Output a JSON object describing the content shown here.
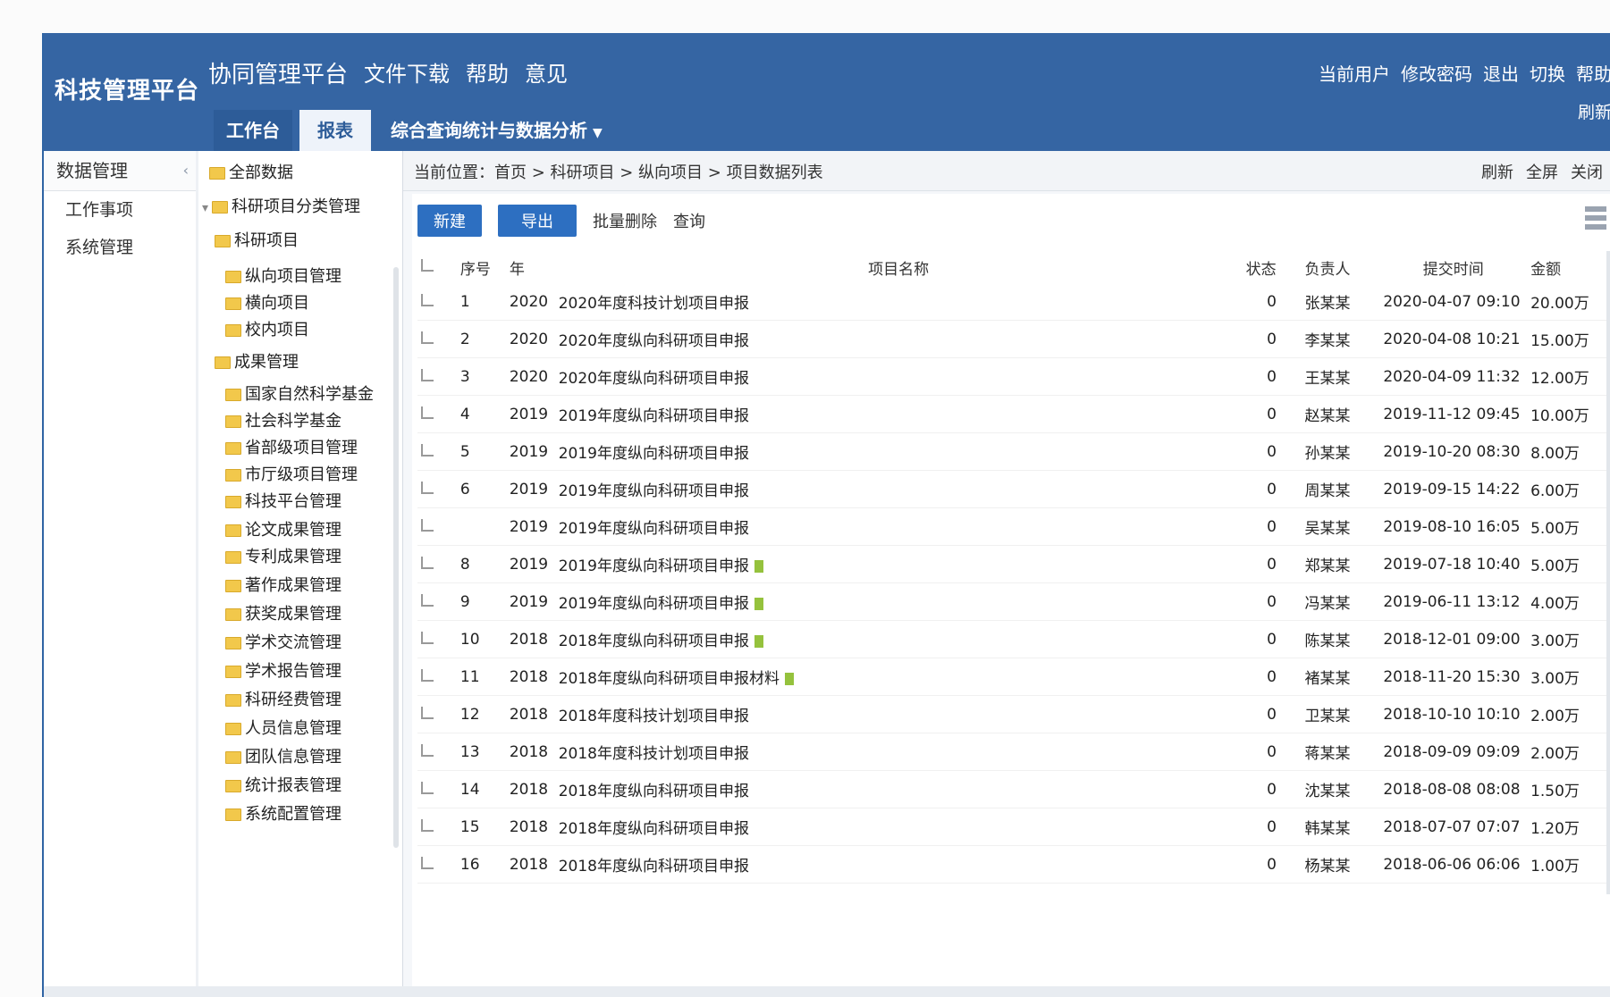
{
  "header": {
    "brand": "科技管理平台",
    "top_links": [
      "协同管理平台",
      "文件下载",
      "帮助",
      "意见"
    ],
    "user_links": [
      "当前用户",
      "修改密码",
      "退出",
      "切换",
      "帮助"
    ],
    "refresh_label": "刷新",
    "nav_tabs": [
      {
        "label": "工作台"
      },
      {
        "label": "报表"
      },
      {
        "label": "综合查询统计与数据分析"
      }
    ]
  },
  "sidebar": {
    "title": "数据管理",
    "items": [
      "工作事项",
      "系统管理"
    ]
  },
  "tree": {
    "nodes": [
      {
        "label": "全部数据"
      },
      {
        "label": "科研项目分类管理"
      },
      {
        "label": "科研项目"
      },
      {
        "label": "纵向项目管理"
      },
      {
        "label": "横向项目"
      },
      {
        "label": "校内项目"
      },
      {
        "label": "成果管理"
      },
      {
        "label": "国家自然科学基金"
      },
      {
        "label": "社会科学基金"
      },
      {
        "label": "省部级项目管理"
      },
      {
        "label": "市厅级项目管理"
      },
      {
        "label": "科技平台管理"
      },
      {
        "label": "论文成果管理"
      },
      {
        "label": "专利成果管理"
      },
      {
        "label": "著作成果管理"
      },
      {
        "label": "获奖成果管理"
      },
      {
        "label": "学术交流管理"
      },
      {
        "label": "学术报告管理"
      },
      {
        "label": "科研经费管理"
      },
      {
        "label": "人员信息管理"
      },
      {
        "label": "团队信息管理"
      },
      {
        "label": "统计报表管理"
      },
      {
        "label": "系统配置管理"
      }
    ]
  },
  "breadcrumb": "当前位置：首页 > 科研项目 > 纵向项目 > 项目数据列表",
  "breadcrumb_actions": [
    "刷新",
    "全屏",
    "关闭"
  ],
  "toolbar": {
    "primary_buttons": [
      "新建",
      "导出"
    ],
    "links": [
      "批量删除",
      "查询"
    ]
  },
  "table": {
    "headers": [
      "",
      "序号",
      "年",
      "项目名称",
      "状态",
      "负责人",
      "提交时间",
      "金额"
    ],
    "rows": [
      {
        "index": "1",
        "year": "2020",
        "name": "2020年度科技计划项目申报",
        "status": "0",
        "owner": "张某某",
        "time": "2020-04-07 09:10",
        "amount": "20.00万"
      },
      {
        "index": "2",
        "year": "2020",
        "name": "2020年度纵向科研项目申报",
        "status": "0",
        "owner": "李某某",
        "time": "2020-04-08 10:21",
        "amount": "15.00万"
      },
      {
        "index": "3",
        "year": "2020",
        "name": "2020年度纵向科研项目申报",
        "status": "0",
        "owner": "王某某",
        "time": "2020-04-09 11:32",
        "amount": "12.00万"
      },
      {
        "index": "4",
        "year": "2019",
        "name": "2019年度纵向科研项目申报",
        "status": "0",
        "owner": "赵某某",
        "time": "2019-11-12 09:45",
        "amount": "10.00万"
      },
      {
        "index": "5",
        "year": "2019",
        "name": "2019年度纵向科研项目申报",
        "status": "0",
        "owner": "孙某某",
        "time": "2019-10-20 08:30",
        "amount": "8.00万"
      },
      {
        "index": "6",
        "year": "2019",
        "name": "2019年度纵向科研项目申报",
        "status": "0",
        "owner": "周某某",
        "time": "2019-09-15 14:22",
        "amount": "6.00万"
      },
      {
        "index": "",
        "year": "2019",
        "name": "2019年度纵向科研项目申报",
        "status": "0",
        "owner": "吴某某",
        "time": "2019-08-10 16:05",
        "amount": "5.00万"
      },
      {
        "index": "8",
        "year": "2019",
        "name": "2019年度纵向科研项目申报",
        "status": "0",
        "owner": "郑某某",
        "time": "2019-07-18 10:40",
        "amount": "5.00万",
        "attach": true
      },
      {
        "index": "9",
        "year": "2019",
        "name": "2019年度纵向科研项目申报",
        "status": "0",
        "owner": "冯某某",
        "time": "2019-06-11 13:12",
        "amount": "4.00万",
        "attach": true
      },
      {
        "index": "10",
        "year": "2018",
        "name": "2018年度纵向科研项目申报",
        "status": "0",
        "owner": "陈某某",
        "time": "2018-12-01 09:00",
        "amount": "3.00万",
        "attach": true
      },
      {
        "index": "11",
        "year": "2018",
        "name": "2018年度纵向科研项目申报材料",
        "status": "0",
        "owner": "褚某某",
        "time": "2018-11-20 15:30",
        "amount": "3.00万",
        "attach": true
      },
      {
        "index": "12",
        "year": "2018",
        "name": "2018年度科技计划项目申报",
        "status": "0",
        "owner": "卫某某",
        "time": "2018-10-10 10:10",
        "amount": "2.00万"
      },
      {
        "index": "13",
        "year": "2018",
        "name": "2018年度科技计划项目申报",
        "status": "0",
        "owner": "蒋某某",
        "time": "2018-09-09 09:09",
        "amount": "2.00万"
      },
      {
        "index": "14",
        "year": "2018",
        "name": "2018年度纵向科研项目申报",
        "status": "0",
        "owner": "沈某某",
        "time": "2018-08-08 08:08",
        "amount": "1.50万"
      },
      {
        "index": "15",
        "year": "2018",
        "name": "2018年度纵向科研项目申报",
        "status": "0",
        "owner": "韩某某",
        "time": "2018-07-07 07:07",
        "amount": "1.20万"
      },
      {
        "index": "16",
        "year": "2018",
        "name": "2018年度纵向科研项目申报",
        "status": "0",
        "owner": "杨某某",
        "time": "2018-06-06 06:06",
        "amount": "1.00万"
      }
    ]
  },
  "colors": {
    "header_bg": "#3565a3",
    "primary_button": "#2d6fc1",
    "attachment": "#95c23d"
  }
}
